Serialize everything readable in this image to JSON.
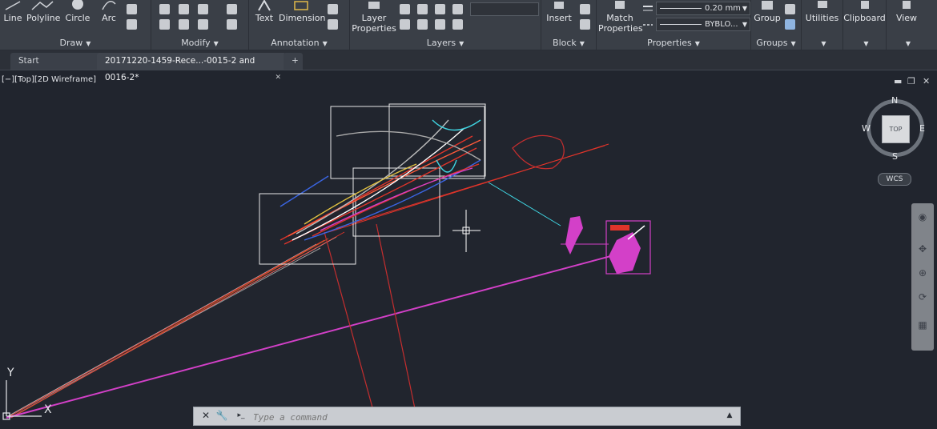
{
  "ribbon": {
    "draw": {
      "title": "Draw",
      "line": "Line",
      "polyline": "Polyline",
      "circle": "Circle",
      "arc": "Arc"
    },
    "modify": {
      "title": "Modify"
    },
    "annotation": {
      "title": "Annotation",
      "text": "Text",
      "dimension": "Dimension"
    },
    "layers": {
      "title": "Layers",
      "layer_properties_1": "Layer",
      "layer_properties_2": "Properties"
    },
    "block": {
      "title": "Block",
      "insert": "Insert"
    },
    "properties": {
      "title": "Properties",
      "match_1": "Match",
      "match_2": "Properties",
      "lineweight": "0.20 mm",
      "linetype": "BYBLO..."
    },
    "groups": {
      "title": "Groups",
      "group": "Group"
    },
    "utilities": "Utilities",
    "clipboard": "Clipboard",
    "view": "View"
  },
  "tabs": {
    "start": "Start",
    "file": "20171220-1459-Rece...-0015-2 and 0016-2*",
    "add": "+"
  },
  "viewport": {
    "label": "[−][Top][2D Wireframe]",
    "minimize": "▬",
    "restore": "❐",
    "close": "✕"
  },
  "viewcube": {
    "top": "TOP",
    "north": "N",
    "south": "S",
    "east": "E",
    "west": "W",
    "wcs": "WCS"
  },
  "ucs": {
    "y": "Y",
    "x": "X"
  },
  "command": {
    "placeholder": "Type a command",
    "close": "✕",
    "customize": "🔧",
    "prompt_icon": "▸_"
  },
  "colors": {
    "background": "#21252e",
    "ribbon": "#3a3f47",
    "magenta": "#d340c8",
    "red": "#e0342a",
    "cyan": "#3fd3e0"
  }
}
